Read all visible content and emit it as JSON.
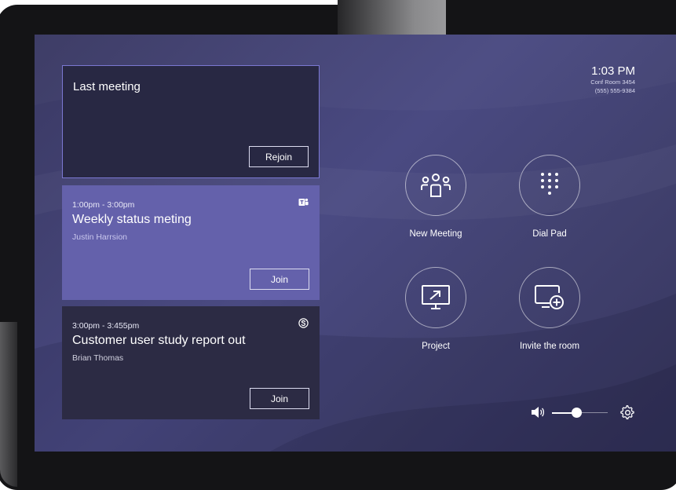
{
  "meetings": {
    "last": {
      "title": "Last meeting",
      "button_label": "Rejoin"
    },
    "items": [
      {
        "time": "1:00pm - 3:00pm",
        "title": "Weekly status meting",
        "organizer": "Justin Harrsion",
        "service_icon": "teams-icon",
        "button_label": "Join"
      },
      {
        "time": "3:00pm - 3:455pm",
        "title": "Customer user study report out",
        "organizer": "Brian Thomas",
        "service_icon": "skype-icon",
        "button_label": "Join"
      }
    ]
  },
  "status": {
    "time": "1:03 PM",
    "room": "Conf Room 3454",
    "phone": "(555) 555-9384"
  },
  "actions": [
    {
      "label": "New Meeting",
      "icon": "people-icon"
    },
    {
      "label": "Dial Pad",
      "icon": "dialpad-icon"
    },
    {
      "label": "Project",
      "icon": "project-screen-icon"
    },
    {
      "label": "Invite the room",
      "icon": "invite-room-icon"
    }
  ],
  "controls": {
    "volume_icon": "volume-icon",
    "volume_level": 0.45,
    "settings_icon": "gear-icon"
  },
  "colors": {
    "screen_bg": "#45457a",
    "last_card": "#282843",
    "active_card": "#6461ab",
    "inactive_card": "#2c2b44",
    "accent_border": "#7b78d2"
  }
}
